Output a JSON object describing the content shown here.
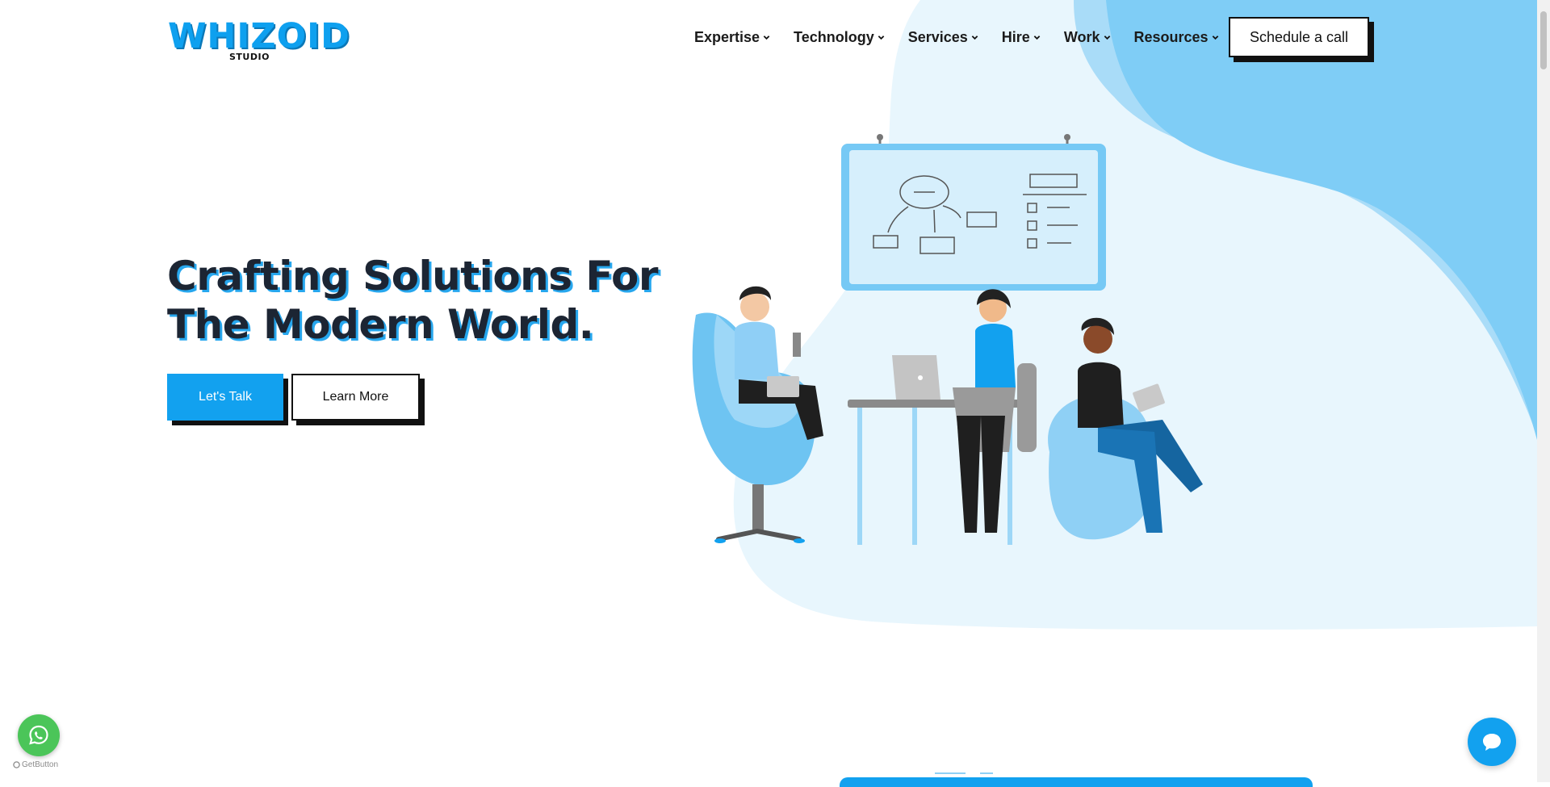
{
  "brand": {
    "name": "WHIZOID",
    "sub": "STUDIO",
    "color": "#0ea0ef"
  },
  "nav": {
    "items": [
      {
        "label": "Expertise"
      },
      {
        "label": "Technology"
      },
      {
        "label": "Services"
      },
      {
        "label": "Hire"
      },
      {
        "label": "Work"
      },
      {
        "label": "Resources"
      }
    ],
    "cta": "Schedule a call"
  },
  "hero": {
    "title_line1": "Crafting Solutions For",
    "title_line2": "The Modern World.",
    "primary_button": "Let's Talk",
    "secondary_button": "Learn More"
  },
  "widgets": {
    "whatsapp_icon": "whatsapp-icon",
    "getbutton_label": "GetButton",
    "chat_icon": "chat-bubble-icon"
  },
  "colors": {
    "accent": "#12a1ef",
    "light_blob": "#e8f6fd",
    "mid_blob": "#7fcdf6",
    "text_dark": "#1c2533"
  }
}
